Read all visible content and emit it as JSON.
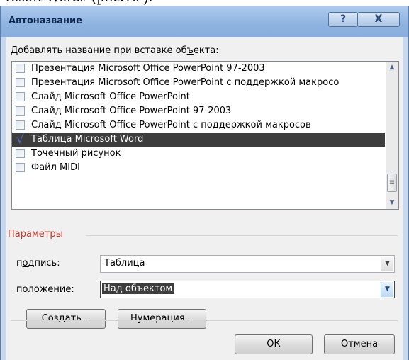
{
  "dialog": {
    "title": "Автоназвание",
    "help_button": "?",
    "close_button": "X",
    "add_caption_label_pre": "Добавлять название при вставке об",
    "add_caption_label_key": "ъ",
    "add_caption_label_post": "екта:",
    "objects": [
      {
        "label": "Презентация Microsoft Office PowerPoint 97-2003",
        "checked": false,
        "selected": false
      },
      {
        "label": "Презентация Microsoft Office PowerPoint с поддержкой макросо",
        "checked": false,
        "selected": false
      },
      {
        "label": "Слайд Microsoft Office PowerPoint",
        "checked": false,
        "selected": false
      },
      {
        "label": "Слайд Microsoft Office PowerPoint 97-2003",
        "checked": false,
        "selected": false
      },
      {
        "label": "Слайд Microsoft Office PowerPoint с поддержкой макросов",
        "checked": false,
        "selected": false
      },
      {
        "label": "Таблица Microsoft Word",
        "checked": true,
        "selected": true
      },
      {
        "label": "Точечный рисунок",
        "checked": false,
        "selected": false
      },
      {
        "label": "Файл MIDI",
        "checked": false,
        "selected": false
      }
    ],
    "params_group_label": "Параметры",
    "caption_label_pre": "п",
    "caption_label_key": "о",
    "caption_label_post": "дпись:",
    "caption_value": "Таблица",
    "position_label_key": "п",
    "position_label_post": "оложение:",
    "position_value": "Над объектом",
    "create_button_pre": "Созд",
    "create_button_key": "а",
    "create_button_post": "ть...",
    "numbering_button_pre": "Ну",
    "numbering_button_key": "м",
    "numbering_button_post": "ерация...",
    "ok_button": "ОК",
    "cancel_button": "Отмена"
  },
  "document_snippet": "rosoft Word» (рис.16 ).",
  "colors": {
    "titlebar": "#8fb3e0",
    "selection": "#3d3d3d",
    "group_label": "#c0392b"
  }
}
